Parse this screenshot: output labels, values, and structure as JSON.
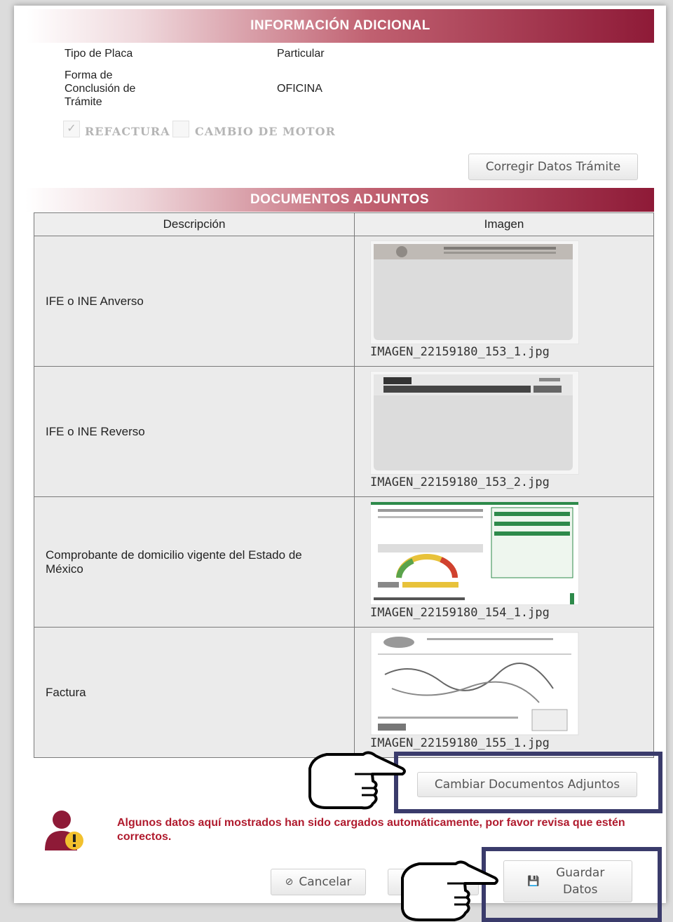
{
  "additional_info": {
    "header": "INFORMACIÓN ADICIONAL",
    "rows": [
      {
        "label": "Tipo de Placa",
        "value": "Particular"
      },
      {
        "label": "Forma de Conclusión de Trámite",
        "value": "OFICINA"
      }
    ],
    "checkboxes": [
      {
        "label": "REFACTURA",
        "checked": true
      },
      {
        "label": "CAMBIO DE MOTOR",
        "checked": false
      }
    ],
    "fix_button": "Corregir Datos Trámite"
  },
  "attachments": {
    "header": "DOCUMENTOS ADJUNTOS",
    "columns": [
      "Descripción",
      "Imagen"
    ],
    "rows": [
      {
        "description": "IFE o INE Anverso",
        "filename": "IMAGEN_22159180_153_1.jpg"
      },
      {
        "description": "IFE o INE Reverso",
        "filename": "IMAGEN_22159180_153_2.jpg"
      },
      {
        "description": "Comprobante de domicilio vigente del Estado de México",
        "filename": "IMAGEN_22159180_154_1.jpg"
      },
      {
        "description": "Factura",
        "filename": "IMAGEN_22159180_155_1.jpg"
      }
    ],
    "change_button": "Cambiar Documentos Adjuntos"
  },
  "warning": {
    "text": "Algunos datos aquí mostrados han sido cargados automáticamente, por favor revisa que estén correctos."
  },
  "footer": {
    "cancel_label": "Cancelar",
    "save_label": "Guardar Datos"
  },
  "colors": {
    "header_dark": "#8e1a37",
    "warning_text": "#b01b2e",
    "highlight_border": "#3a3b6b"
  }
}
